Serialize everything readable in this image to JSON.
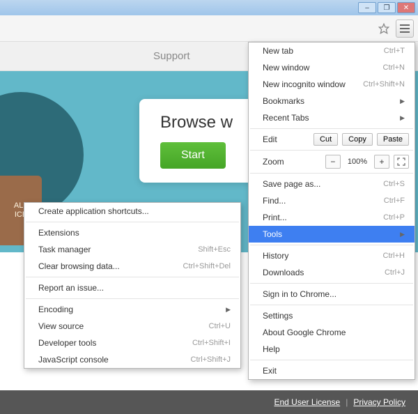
{
  "window": {
    "min": "–",
    "max": "❐",
    "close": "✕"
  },
  "page": {
    "support_tab": "Support",
    "hero_heading": "Browse w",
    "start_label": "Start",
    "badge_line1": "ALF",
    "badge_line2": "ICE"
  },
  "footer": {
    "eula": "End User License",
    "privacy": "Privacy Policy"
  },
  "menu": {
    "new_tab": "New tab",
    "sc_new_tab": "Ctrl+T",
    "new_window": "New window",
    "sc_new_window": "Ctrl+N",
    "incognito": "New incognito window",
    "sc_incognito": "Ctrl+Shift+N",
    "bookmarks": "Bookmarks",
    "recent": "Recent Tabs",
    "edit": "Edit",
    "cut": "Cut",
    "copy": "Copy",
    "paste": "Paste",
    "zoom": "Zoom",
    "zoom_val": "100%",
    "save": "Save page as...",
    "sc_save": "Ctrl+S",
    "find": "Find...",
    "sc_find": "Ctrl+F",
    "print": "Print...",
    "sc_print": "Ctrl+P",
    "tools": "Tools",
    "history": "History",
    "sc_history": "Ctrl+H",
    "downloads": "Downloads",
    "sc_downloads": "Ctrl+J",
    "signin": "Sign in to Chrome...",
    "settings": "Settings",
    "about": "About Google Chrome",
    "help": "Help",
    "exit": "Exit"
  },
  "submenu": {
    "create_shortcuts": "Create application shortcuts...",
    "extensions": "Extensions",
    "task_manager": "Task manager",
    "sc_task": "Shift+Esc",
    "clear_data": "Clear browsing data...",
    "sc_clear": "Ctrl+Shift+Del",
    "report": "Report an issue...",
    "encoding": "Encoding",
    "view_source": "View source",
    "sc_source": "Ctrl+U",
    "dev_tools": "Developer tools",
    "sc_dev": "Ctrl+Shift+I",
    "js_console": "JavaScript console",
    "sc_js": "Ctrl+Shift+J"
  }
}
